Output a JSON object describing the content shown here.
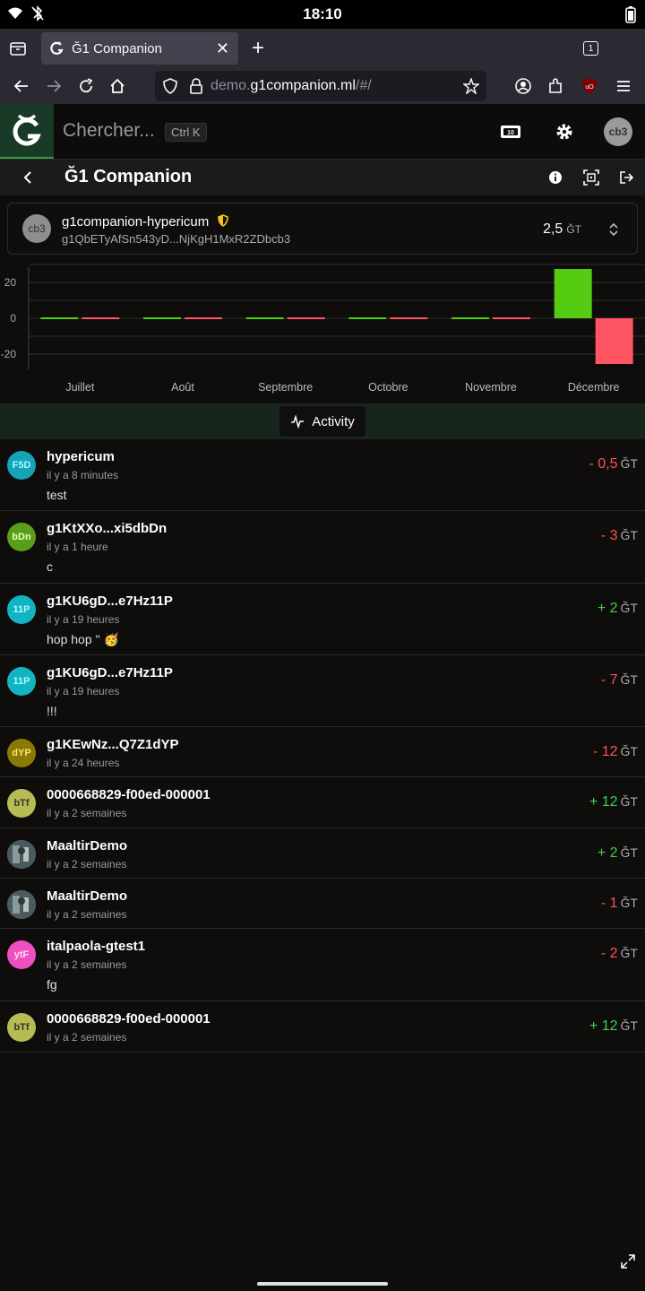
{
  "status": {
    "time": "18:10"
  },
  "browser": {
    "tab_title": "Ğ1 Companion",
    "tab_count": "1",
    "url_prefix": "demo.",
    "url_domain": "g1companion.ml",
    "url_suffix": "/#/"
  },
  "app": {
    "search_placeholder": "Chercher...",
    "shortcut": "Ctrl K",
    "user_avatar": "cb3",
    "page_title": "Ğ1 Companion"
  },
  "wallet": {
    "avatar": "cb3",
    "name": "g1companion-hypericum",
    "address": "g1QbETyAfSn543yD...NjKgH1MxR2ZDbcb3",
    "balance": "2,5",
    "currency": "ĞT"
  },
  "chart_data": {
    "type": "bar",
    "categories": [
      "Juillet",
      "Août",
      "Septembre",
      "Octobre",
      "Novembre",
      "Décembre"
    ],
    "series": [
      {
        "values": [
          0,
          0,
          0,
          0,
          0,
          27.5
        ],
        "color": "#55cc11"
      },
      {
        "values": [
          0,
          0,
          0,
          0,
          0,
          -25.5
        ],
        "color": "#ff5563"
      }
    ],
    "yticks": [
      "20",
      "0",
      "-20"
    ],
    "ylim": [
      -28,
      28
    ],
    "grid": true
  },
  "activity_label": "Activity",
  "transactions": [
    {
      "avatar": "F5D",
      "avatar_bg": "#17a2b8",
      "avatar_fg": "#9ff",
      "name": "hypericum",
      "time": "il y a 8 minutes",
      "comment": "test",
      "amount": "- 0,5",
      "sign": "neg",
      "currency": "ĞT"
    },
    {
      "avatar": "bDn",
      "avatar_bg": "#5a9d1a",
      "avatar_fg": "#dfffc0",
      "name": "g1KtXXo...xi5dbDn",
      "time": "il y a 1 heure",
      "comment": "c",
      "amount": "- 3",
      "sign": "neg",
      "currency": "ĞT"
    },
    {
      "avatar": "11P",
      "avatar_bg": "#13b3c2",
      "avatar_fg": "#aaffff",
      "name": "g1KU6gD...e7Hz11P",
      "time": "il y a 19 heures",
      "comment": "hop hop '' 🥳",
      "amount": "+ 2",
      "sign": "pos",
      "currency": "ĞT"
    },
    {
      "avatar": "11P",
      "avatar_bg": "#13b3c2",
      "avatar_fg": "#aaffff",
      "name": "g1KU6gD...e7Hz11P",
      "time": "il y a 19 heures",
      "comment": "!!!",
      "amount": "- 7",
      "sign": "neg",
      "currency": "ĞT"
    },
    {
      "avatar": "dYP",
      "avatar_bg": "#8a7a05",
      "avatar_fg": "#ffe36a",
      "name": "g1KEwNz...Q7Z1dYP",
      "time": "il y a 24 heures",
      "comment": "",
      "amount": "- 12",
      "sign": "neg",
      "currency": "ĞT"
    },
    {
      "avatar": "bTf",
      "avatar_bg": "#b7bb53",
      "avatar_fg": "#333",
      "name": "0000668829-f00ed-000001",
      "time": "il y a 2 semaines",
      "comment": "",
      "amount": "+ 12",
      "sign": "pos",
      "currency": "ĞT"
    },
    {
      "avatar": "img",
      "avatar_bg": "#5b6a6e",
      "avatar_fg": "#fff",
      "name": "MaaltirDemo",
      "time": "il y a 2 semaines",
      "comment": "",
      "amount": "+ 2",
      "sign": "pos",
      "currency": "ĞT"
    },
    {
      "avatar": "img",
      "avatar_bg": "#5b6a6e",
      "avatar_fg": "#fff",
      "name": "MaaltirDemo",
      "time": "il y a 2 semaines",
      "comment": "",
      "amount": "- 1",
      "sign": "neg",
      "currency": "ĞT"
    },
    {
      "avatar": "ytF",
      "avatar_bg": "#f04fc0",
      "avatar_fg": "#ffe0f6",
      "name": "italpaola-gtest1",
      "time": "il y a 2 semaines",
      "comment": "fg",
      "amount": "- 2",
      "sign": "neg",
      "currency": "ĞT"
    },
    {
      "avatar": "bTf",
      "avatar_bg": "#b7bb53",
      "avatar_fg": "#333",
      "name": "0000668829-f00ed-000001",
      "time": "il y a 2 semaines",
      "comment": "",
      "amount": "+ 12",
      "sign": "pos",
      "currency": "ĞT"
    }
  ]
}
